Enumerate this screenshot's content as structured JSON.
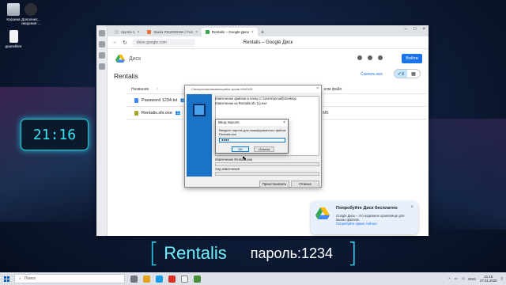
{
  "desktop": {
    "icons": [
      {
        "label": "Корзина",
        "icon": "recycle-bin-icon"
      },
      {
        "label": "Дополнит... сведения ...",
        "icon": "info-icon"
      },
      {
        "label": "guanelibre",
        "icon": "file-icon"
      }
    ],
    "clock_widget": "21:16"
  },
  "browser": {
    "tabs": [
      {
        "label": "группа 1",
        "active": false
      },
      {
        "label": "Заказ #XUEN0194 / Fun",
        "active": false
      },
      {
        "label": "Rentalis – Google Диск",
        "active": true
      }
    ],
    "url": "drive.google.com",
    "page_title": "Rentalis – Google Диск",
    "drive": {
      "product": "Диск",
      "login_button": "Войти",
      "folder_title": "Rentalis",
      "download_all": "Скачать все",
      "columns": {
        "name": "Название",
        "sort_icon": "arrow-up-icon",
        "size_partial": "ком файл"
      },
      "files": [
        {
          "name": "Password 1234.txt",
          "type": "txt"
        },
        {
          "name": "Rentalis.sfx.exe",
          "type": "exe",
          "size": "9 МБ"
        }
      ],
      "promo": {
        "title": "Попробуйте Диск бесплатно",
        "desc": "Google Диск – это надежное хранилище для ваших файлов.",
        "link": "Попробуйте прямо сейчас!"
      }
    }
  },
  "winrar": {
    "title": "Самораспаковывающийся архив WinRAR",
    "line1": "Извлечение файлов в папку C:\\Users\\(email)\\Desktop",
    "line2": "Извлечение из Rentalis.sfx (1).exe",
    "status_label": "Извлечение Rentalis.exe",
    "progress_label": "Ход извлечения",
    "progress": 0,
    "pause_btn": "Приостановить",
    "cancel_btn": "Отмена"
  },
  "password_dialog": {
    "title": "Ввод пароля",
    "prompt1": "Введите пароль для зашифрованного файла:",
    "prompt2": "Rentalis.exe",
    "value": "●●●●",
    "ok": "OK",
    "cancel": "Отмена"
  },
  "caption": {
    "name": "Rentalis",
    "password": "пароль:1234"
  },
  "taskbar": {
    "search_placeholder": "Поиск",
    "lang": "ENG",
    "time": "21:16",
    "date": "27.01.2025"
  }
}
